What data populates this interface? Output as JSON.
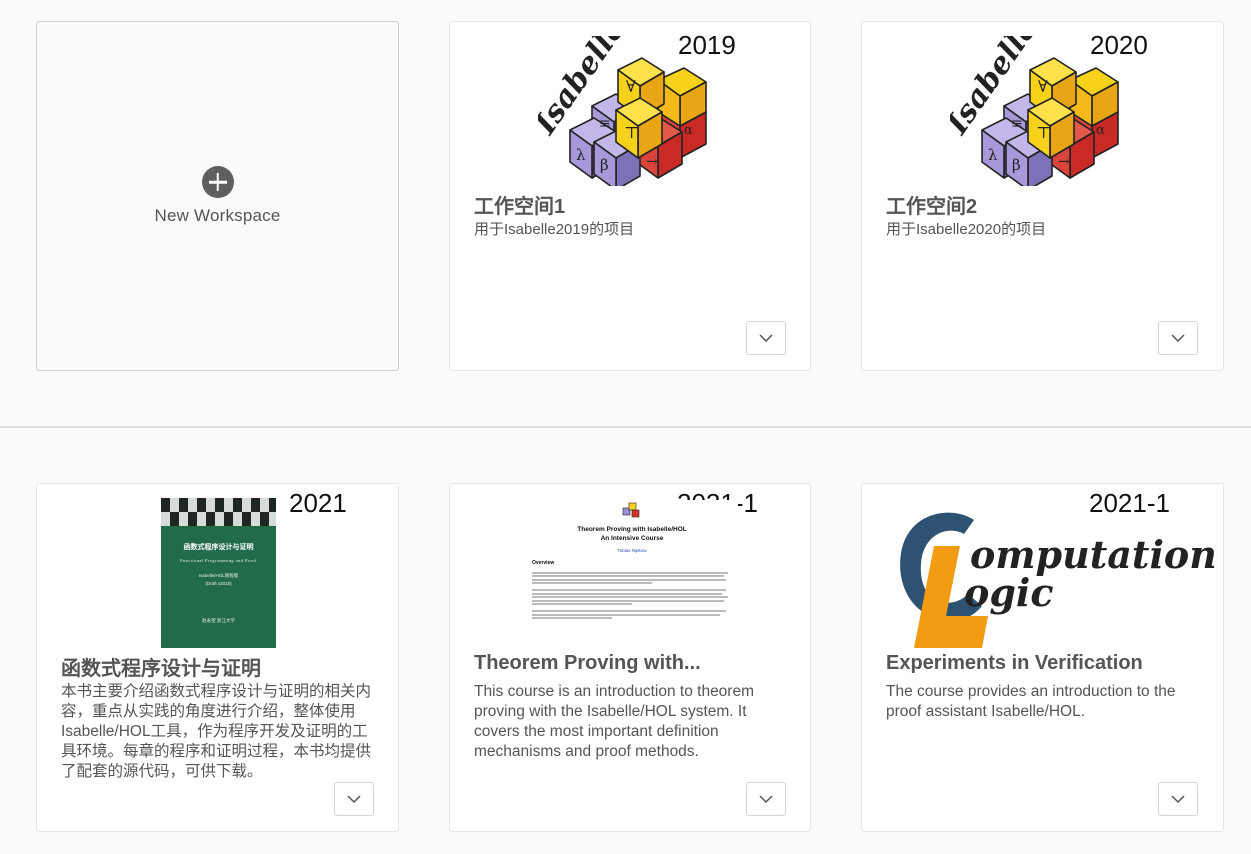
{
  "new_workspace": {
    "label": "New Workspace",
    "icon": "plus-circle-icon"
  },
  "cards": [
    {
      "year": "2019",
      "logo_text": "Isabelle",
      "title": "工作空间1",
      "description": "用于Isabelle2019的项目"
    },
    {
      "year": "2020",
      "logo_text": "Isabelle",
      "title": "工作空间2",
      "description": "用于Isabelle2020的项目"
    },
    {
      "year": "2021",
      "title": "函数式程序设计与证明",
      "description": "本书主要介绍函数式程序设计与证明的相关内容，重点从实践的角度进行介绍，整体使用Isabelle/HOL工具，作为程序开发及证明的工具环境。每章的程序和证明过程，本书均提供了配套的源代码，可供下载。",
      "book": {
        "title": "函数式程序设计与证明",
        "subtitle": "Functional Programming and Proof",
        "edition": "Isabelle/HOL教程版",
        "draft": "(Draft v2018)",
        "authors": "赵永望 浙江大学"
      }
    },
    {
      "year": "2021-1",
      "title": "Theorem Proving with...",
      "description": "This course is an introduction to theorem proving with the Isabelle/HOL system. It covers the most important definition mechanisms and proof methods.",
      "doc": {
        "title": "Theorem Proving with Isabelle/HOL",
        "subtitle": "An Intensive Course",
        "author": "Tobias Nipkow",
        "heading": "Overview"
      }
    },
    {
      "year": "2021-1",
      "title": "Experiments in Verification",
      "description": "The course provides an introduction to the proof assistant Isabelle/HOL.",
      "logo": {
        "line1": "omputational",
        "line2": "ogic"
      }
    }
  ],
  "colors": {
    "isabelle_yellow": "#f7d21a",
    "isabelle_red": "#d2332c",
    "isabelle_purple": "#9b8fcf",
    "book_green": "#216b4a",
    "logic_blue": "#2d5272",
    "logic_orange": "#f39c12"
  }
}
